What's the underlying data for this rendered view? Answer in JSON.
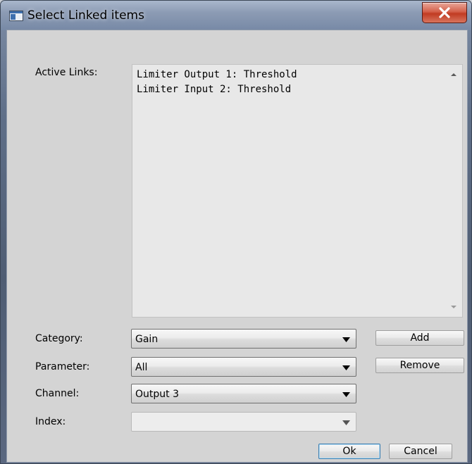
{
  "window": {
    "title": "Select Linked items",
    "close_glyph": "X",
    "icon": "app-window-icon"
  },
  "active_links": {
    "label": "Active Links:",
    "items": [
      "Limiter Output 1: Threshold",
      "Limiter Input 2: Threshold"
    ]
  },
  "fields": {
    "category": {
      "label": "Category:",
      "value": "Gain"
    },
    "parameter": {
      "label": "Parameter:",
      "value": "All"
    },
    "channel": {
      "label": "Channel:",
      "value": "Output 3"
    },
    "index": {
      "label": "Index:",
      "value": ""
    }
  },
  "buttons": {
    "add": "Add",
    "remove": "Remove",
    "ok": "Ok",
    "cancel": "Cancel"
  },
  "colors": {
    "close_button": "#c13b22",
    "dialog_background": "#d4d4d4",
    "default_button_border": "#3c7fb1"
  }
}
